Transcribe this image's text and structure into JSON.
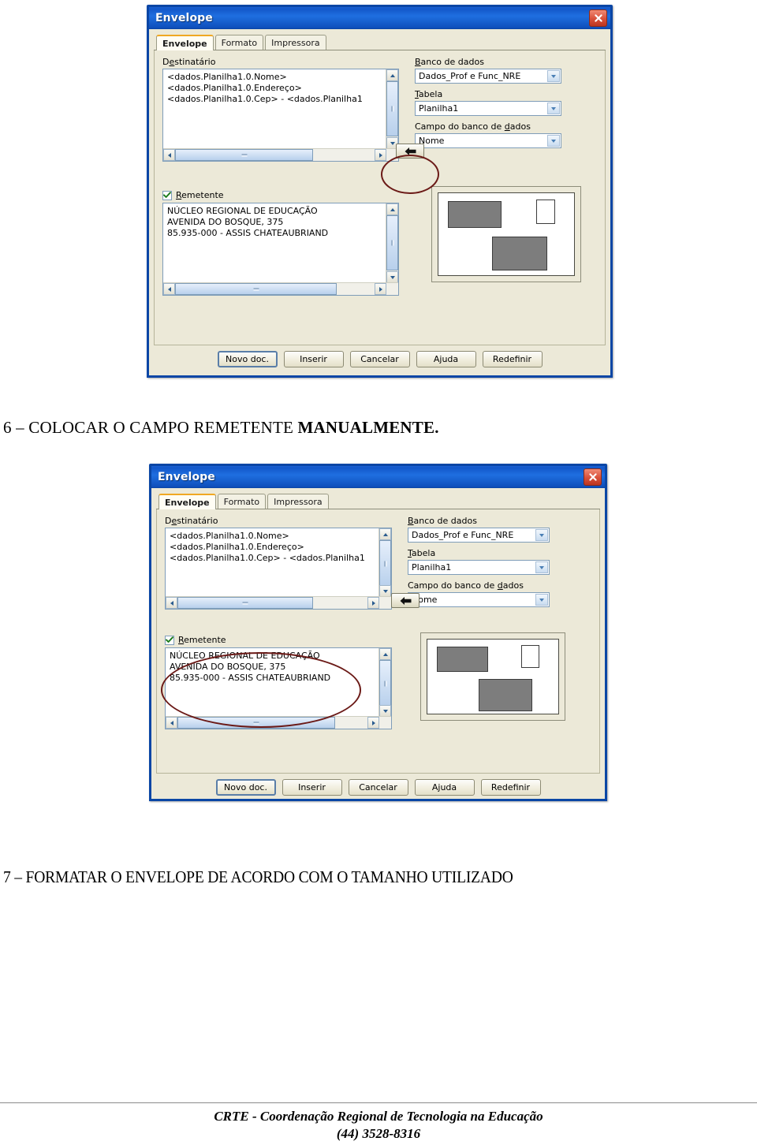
{
  "page": {
    "caption_1_prefix": "6 – COLOCAR O CAMPO REMETENTE ",
    "caption_1_bold": "MANUALMENTE.",
    "caption_2": "7 – FORMATAR O ENVELOPE DE ACORDO COM O TAMANHO UTILIZADO",
    "footer_line1": "CRTE - Coordenação Regional de Tecnologia na Educação",
    "footer_line2": "(44) 3528-8316"
  },
  "colors": {
    "titlebar": "#1257c9",
    "dialog_face": "#ece9d8",
    "annotation_red": "#6b1a17",
    "tab_accent": "#f0a823",
    "field_border": "#7f9db9"
  },
  "dialog": {
    "title": "Envelope",
    "close_icon": "close-icon",
    "tabs": [
      {
        "label": "Envelope",
        "active": true
      },
      {
        "label": "Formato",
        "active": false
      },
      {
        "label": "Impressora",
        "active": false
      }
    ],
    "recipient": {
      "label": "Destinatário",
      "label_accesskey": "e",
      "lines": [
        "<dados.Planilha1.0.Nome>",
        "<dados.Planilha1.0.Endereço>",
        "<dados.Planilha1.0.Cep> - <dados.Planilha1"
      ]
    },
    "sender": {
      "checkbox_label": "Remetente",
      "checkbox_checked": true,
      "lines": [
        "NÚCLEO REGIONAL DE EDUCAÇÃO",
        "AVENIDA DO BOSQUE, 375",
        "85.935-000 - ASSIS CHATEAUBRIAND"
      ]
    },
    "database": {
      "label": "Banco de dados",
      "value": "Dados_Prof e Func_NRE"
    },
    "table": {
      "label": "Tabela",
      "value": "Planilha1"
    },
    "db_field": {
      "label": "Campo do banco de dados",
      "value": "Nome"
    },
    "insert_arrow_button": "←",
    "buttons": [
      {
        "label": "Novo doc.",
        "default": true
      },
      {
        "label": "Inserir",
        "default": false
      },
      {
        "label": "Cancelar",
        "default": false
      },
      {
        "label": "Ajuda",
        "default": false
      },
      {
        "label": "Redefinir",
        "default": false
      }
    ],
    "preview": {
      "sender_box": "sender-block",
      "stamp_box": "stamp-block",
      "recipient_box": "recipient-block"
    }
  },
  "annotations": {
    "dialog1_ellipse_target": "insert-arrow-button",
    "dialog2_ellipse_target": "sender-textarea"
  }
}
